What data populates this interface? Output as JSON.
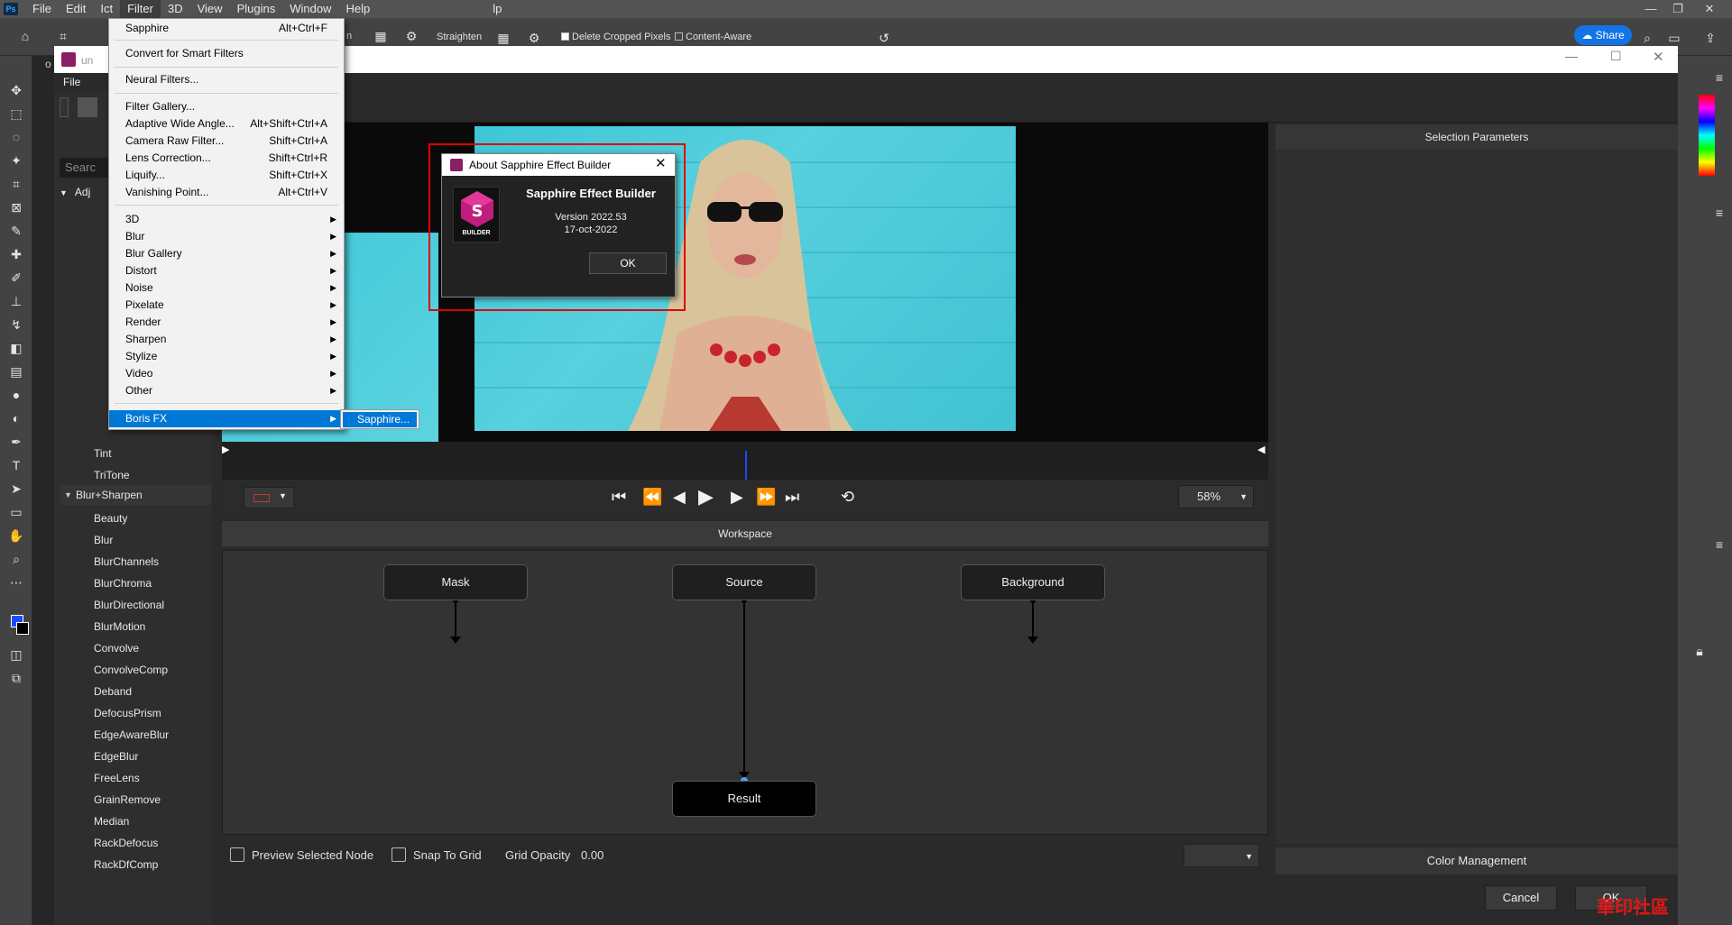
{
  "photoshop": {
    "logo": "Ps",
    "menu": [
      "File",
      "Edit",
      "Ict",
      "Filter",
      "3D",
      "View",
      "Plugins",
      "Window",
      "Help"
    ],
    "menu_trailing": "lp",
    "options": {
      "straighten": "Straighten",
      "delete_cropped": "Delete Cropped Pixels",
      "content_aware": "Content-Aware",
      "share": "Share"
    },
    "partial_labels": {
      "doc_tab": "un",
      "partial_o": "o",
      "n_label": "n"
    }
  },
  "filter_menu": {
    "items": [
      {
        "label": "Sapphire",
        "shortcut": "Alt+Ctrl+F"
      },
      {
        "label": "Convert for Smart Filters"
      },
      {
        "label": "Neural Filters..."
      },
      {
        "label": "Filter Gallery..."
      },
      {
        "label": "Adaptive Wide Angle...",
        "shortcut": "Alt+Shift+Ctrl+A"
      },
      {
        "label": "Camera Raw Filter...",
        "shortcut": "Shift+Ctrl+A"
      },
      {
        "label": "Lens Correction...",
        "shortcut": "Shift+Ctrl+R"
      },
      {
        "label": "Liquify...",
        "shortcut": "Shift+Ctrl+X"
      },
      {
        "label": "Vanishing Point...",
        "shortcut": "Alt+Ctrl+V"
      },
      {
        "label": "3D"
      },
      {
        "label": "Blur"
      },
      {
        "label": "Blur Gallery"
      },
      {
        "label": "Distort"
      },
      {
        "label": "Noise"
      },
      {
        "label": "Pixelate"
      },
      {
        "label": "Render"
      },
      {
        "label": "Sharpen"
      },
      {
        "label": "Stylize"
      },
      {
        "label": "Video"
      },
      {
        "label": "Other"
      },
      {
        "label": "Boris FX"
      }
    ],
    "submenu_item": "Sapphire..."
  },
  "sapphire": {
    "file_menu": "File",
    "search_placeholder": "Searc",
    "group_adj": "Adj",
    "effects_top": [
      "Tint",
      "TriTone"
    ],
    "group_blur": "Blur+Sharpen",
    "effects": [
      "Beauty",
      "Blur",
      "BlurChannels",
      "BlurChroma",
      "BlurDirectional",
      "BlurMotion",
      "Convolve",
      "ConvolveComp",
      "Deband",
      "DefocusPrism",
      "EdgeAwareBlur",
      "EdgeBlur",
      "FreeLens",
      "GrainRemove",
      "Median",
      "RackDefocus",
      "RackDfComp"
    ],
    "zoom": "58%",
    "workspace_label": "Workspace",
    "nodes": {
      "mask": "Mask",
      "source": "Source",
      "background": "Background",
      "result": "Result"
    },
    "preview_selected": "Preview Selected Node",
    "snap_to_grid": "Snap To Grid",
    "grid_opacity_label": "Grid Opacity",
    "grid_opacity_value": "0.00",
    "selection_parameters": "Selection Parameters",
    "color_management": "Color Management",
    "cancel": "Cancel",
    "ok": "OK"
  },
  "about_dialog": {
    "title": "About Sapphire Effect Builder",
    "product": "Sapphire Effect Builder",
    "version": "Version 2022.53",
    "date": "17-oct-2022",
    "ok": "OK",
    "logo_letter": "S",
    "logo_caption": "BUILDER"
  },
  "watermark": "華印社區",
  "colors": {
    "accent_blue": "#0078d7",
    "ps_share": "#1473e6",
    "highlight_frame": "#e00000",
    "photo_teal": "#41c2d2",
    "playhead": "#1d4bff"
  }
}
